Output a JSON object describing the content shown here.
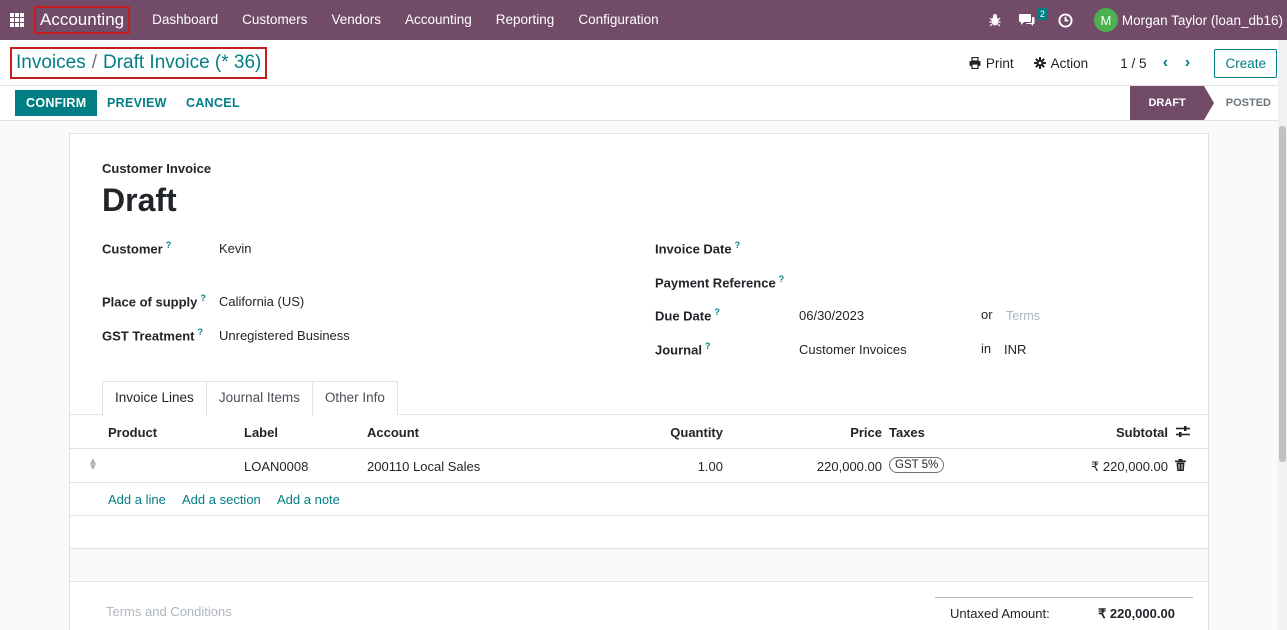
{
  "navbar": {
    "brand": "Accounting",
    "menu": [
      "Dashboard",
      "Customers",
      "Vendors",
      "Accounting",
      "Reporting",
      "Configuration"
    ],
    "chat_count": "2",
    "avatar_initial": "M",
    "user": "Morgan Taylor (loan_db16)"
  },
  "breadcrumb": {
    "parent": "Invoices",
    "separator": "/",
    "current": "Draft Invoice (* 36)"
  },
  "actions": {
    "print": "Print",
    "action": "Action",
    "pager": "1 / 5",
    "create": "Create"
  },
  "statusbar": {
    "confirm": "CONFIRM",
    "preview": "PREVIEW",
    "cancel": "CANCEL",
    "states": [
      "DRAFT",
      "POSTED"
    ],
    "active_state": "DRAFT"
  },
  "form": {
    "type": "Customer Invoice",
    "title": "Draft",
    "left_fields": [
      {
        "label": "Customer",
        "value": "Kevin"
      },
      {
        "label": "Place of supply",
        "value": "California (US)"
      },
      {
        "label": "GST Treatment",
        "value": "Unregistered Business"
      }
    ],
    "right_fields": [
      {
        "label": "Invoice Date",
        "value": ""
      },
      {
        "label": "Payment Reference",
        "value": ""
      },
      {
        "label": "Due Date",
        "value": "06/30/2023",
        "connector": "or",
        "extra_placeholder": "Terms"
      },
      {
        "label": "Journal",
        "value": "Customer Invoices",
        "connector": "in",
        "extra": "INR"
      }
    ],
    "tooltip_mark": "?"
  },
  "tabs": [
    "Invoice Lines",
    "Journal Items",
    "Other Info"
  ],
  "lines": {
    "headers": [
      "Product",
      "Label",
      "Account",
      "Quantity",
      "Price",
      "Taxes",
      "Subtotal"
    ],
    "rows": [
      {
        "product": "",
        "label": "LOAN0008",
        "account": "200110 Local Sales",
        "quantity": "1.00",
        "price": "220,000.00",
        "tax": "GST 5%",
        "subtotal": "₹ 220,000.00"
      }
    ],
    "add_links": [
      "Add a line",
      "Add a section",
      "Add a note"
    ]
  },
  "footer": {
    "terms_placeholder": "Terms and Conditions",
    "untaxed_label": "Untaxed Amount:",
    "untaxed_value": "₹ 220,000.00"
  },
  "colors": {
    "brand": "#714b67",
    "accent": "#017e84",
    "highlight_border": "#c41e1e"
  }
}
